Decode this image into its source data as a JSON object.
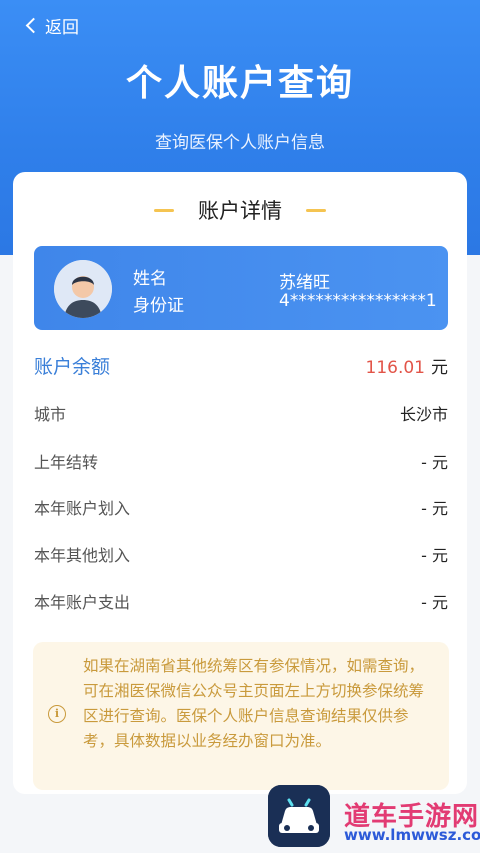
{
  "nav": {
    "back_label": "返回"
  },
  "header": {
    "title": "个人账户查询",
    "subtitle": "查询医保个人账户信息"
  },
  "card": {
    "section_title": "账户详情"
  },
  "user": {
    "name_label": "姓名",
    "id_label": "身份证",
    "name_value": "苏绪旺",
    "id_value": "4****************1"
  },
  "balance": {
    "label": "账户余额",
    "amount": "116.01",
    "unit": "元"
  },
  "rows": [
    {
      "label": "城市",
      "value": "长沙市"
    },
    {
      "label": "上年结转",
      "value": "- 元"
    },
    {
      "label": "本年账户划入",
      "value": "- 元"
    },
    {
      "label": "本年其他划入",
      "value": "- 元"
    },
    {
      "label": "本年账户支出",
      "value": "- 元"
    }
  ],
  "notice": {
    "icon_glyph": "i",
    "text": "如果在湖南省其他统筹区有参保情况，如需查询，可在湘医保微信公众号主页面左上方切换参保统筹区进行查询。医保个人账户信息查询结果仅供参考，具体数据以业务经办窗口为准。"
  },
  "watermark": {
    "title": "道车手游网",
    "url": "www.lmwwsz.com"
  },
  "colors": {
    "header_blue": "#2f7fea",
    "balance_red": "#e25448",
    "notice_bg": "#fdf6e7",
    "notice_text": "#c99a3c"
  }
}
